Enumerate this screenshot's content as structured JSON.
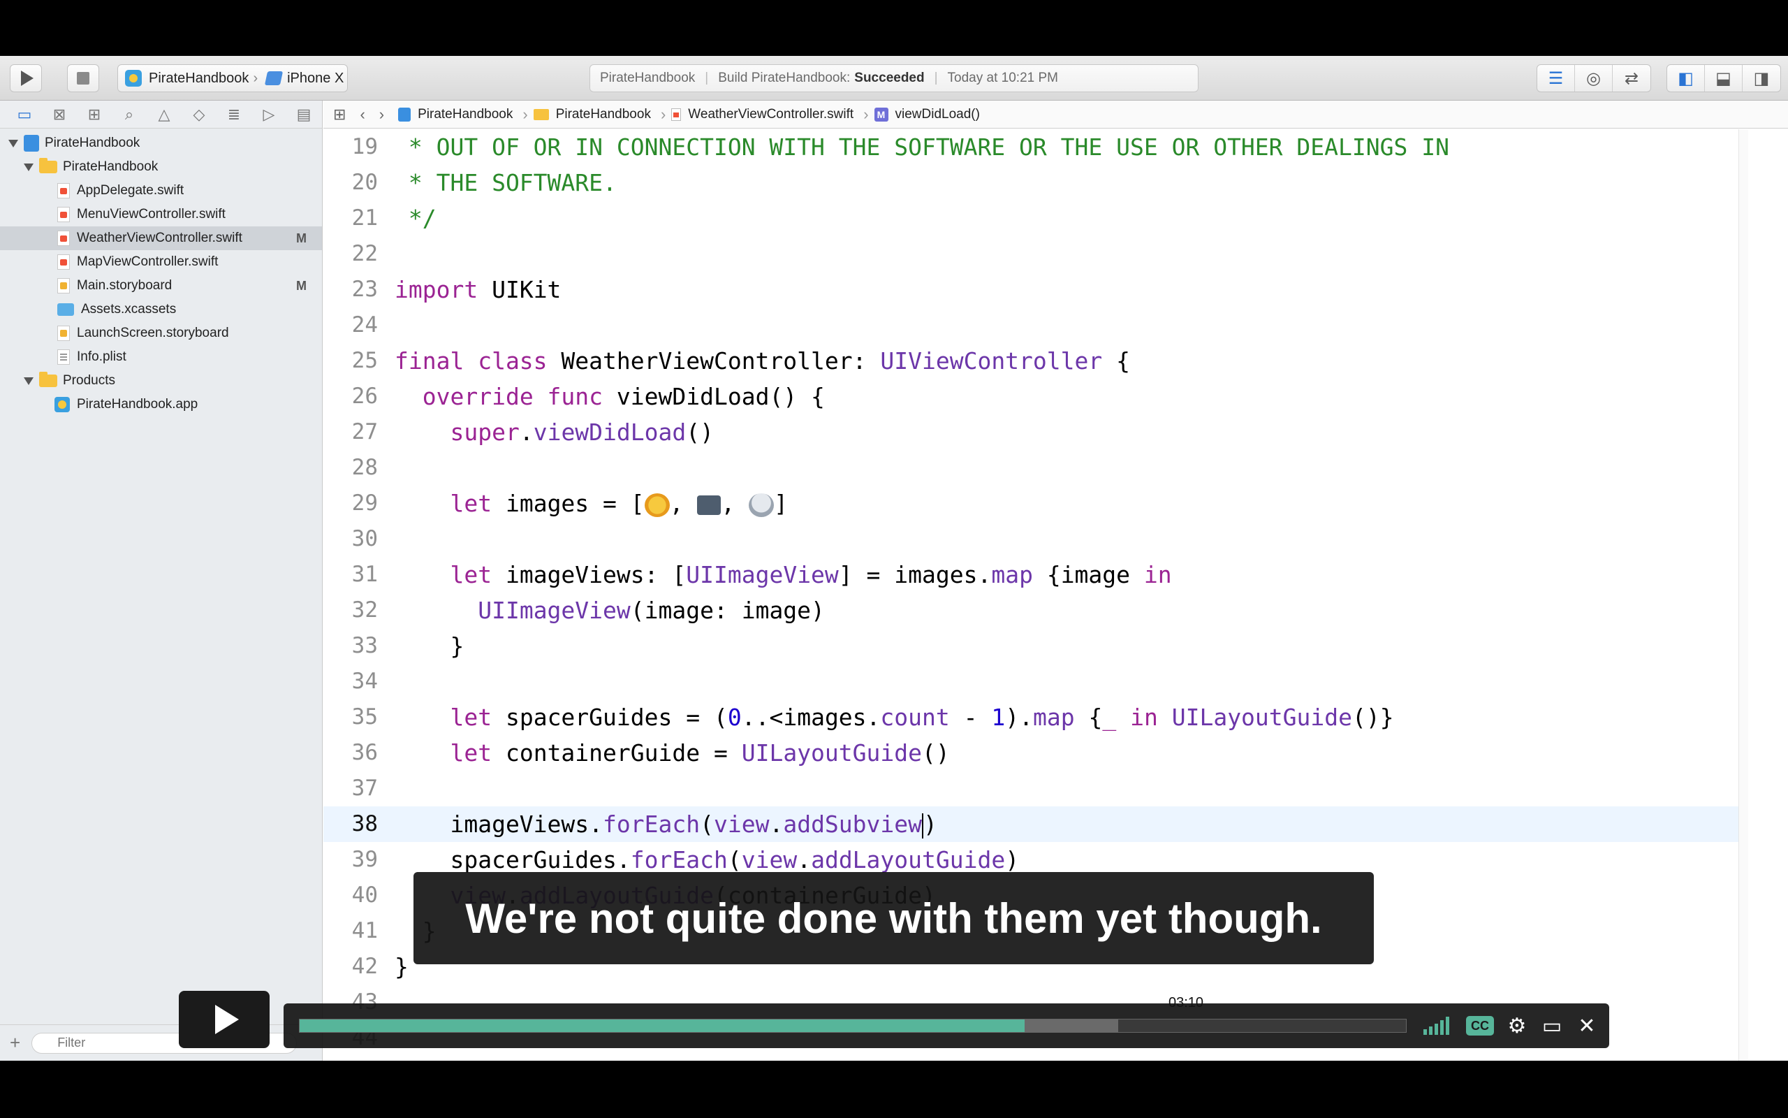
{
  "toolbar": {
    "scheme": "PirateHandbook",
    "device": "iPhone X",
    "activity": {
      "project": "PirateHandbook",
      "build_label": "Build PirateHandbook:",
      "build_status": "Succeeded",
      "time": "Today at 10:21 PM"
    }
  },
  "navigator": {
    "items": [
      {
        "label": "PirateHandbook",
        "kind": "project",
        "depth": 0,
        "badge": ""
      },
      {
        "label": "PirateHandbook",
        "kind": "folder",
        "depth": 1,
        "badge": ""
      },
      {
        "label": "AppDelegate.swift",
        "kind": "swift",
        "depth": 2,
        "badge": ""
      },
      {
        "label": "MenuViewController.swift",
        "kind": "swift",
        "depth": 2,
        "badge": ""
      },
      {
        "label": "WeatherViewController.swift",
        "kind": "swift",
        "depth": 2,
        "badge": "M"
      },
      {
        "label": "MapViewController.swift",
        "kind": "swift",
        "depth": 2,
        "badge": ""
      },
      {
        "label": "Main.storyboard",
        "kind": "storyboard",
        "depth": 2,
        "badge": "M"
      },
      {
        "label": "Assets.xcassets",
        "kind": "assets",
        "depth": 2,
        "badge": ""
      },
      {
        "label": "LaunchScreen.storyboard",
        "kind": "storyboard",
        "depth": 2,
        "badge": ""
      },
      {
        "label": "Info.plist",
        "kind": "plist",
        "depth": 2,
        "badge": ""
      },
      {
        "label": "Products",
        "kind": "folder",
        "depth": 1,
        "badge": ""
      },
      {
        "label": "PirateHandbook.app",
        "kind": "app",
        "depth": 2,
        "badge": ""
      }
    ],
    "filter_placeholder": "Filter"
  },
  "jumpbar": {
    "crumbs": [
      "PirateHandbook",
      "PirateHandbook",
      "WeatherViewController.swift",
      "viewDidLoad()"
    ]
  },
  "editor": {
    "current_line": "38",
    "line_numbers": [
      "19",
      "20",
      "21",
      "22",
      "23",
      "24",
      "25",
      "26",
      "27",
      "28",
      "29",
      "30",
      "31",
      "32",
      "33",
      "34",
      "35",
      "36",
      "37",
      "38",
      "39",
      "40",
      "41",
      "42",
      "43",
      "44"
    ]
  },
  "caption": {
    "text": "We're not quite done with them yet though."
  },
  "video": {
    "timestamp": "03:10",
    "progress": 0.655,
    "buffered": 0.74,
    "accent": "#57b59a"
  },
  "colors": {
    "comment": "#2a8a2a",
    "keyword": "#9b2393",
    "type": "#6c36a9",
    "selection": "#cfd3d8",
    "current_line": "#ecf5ff"
  }
}
